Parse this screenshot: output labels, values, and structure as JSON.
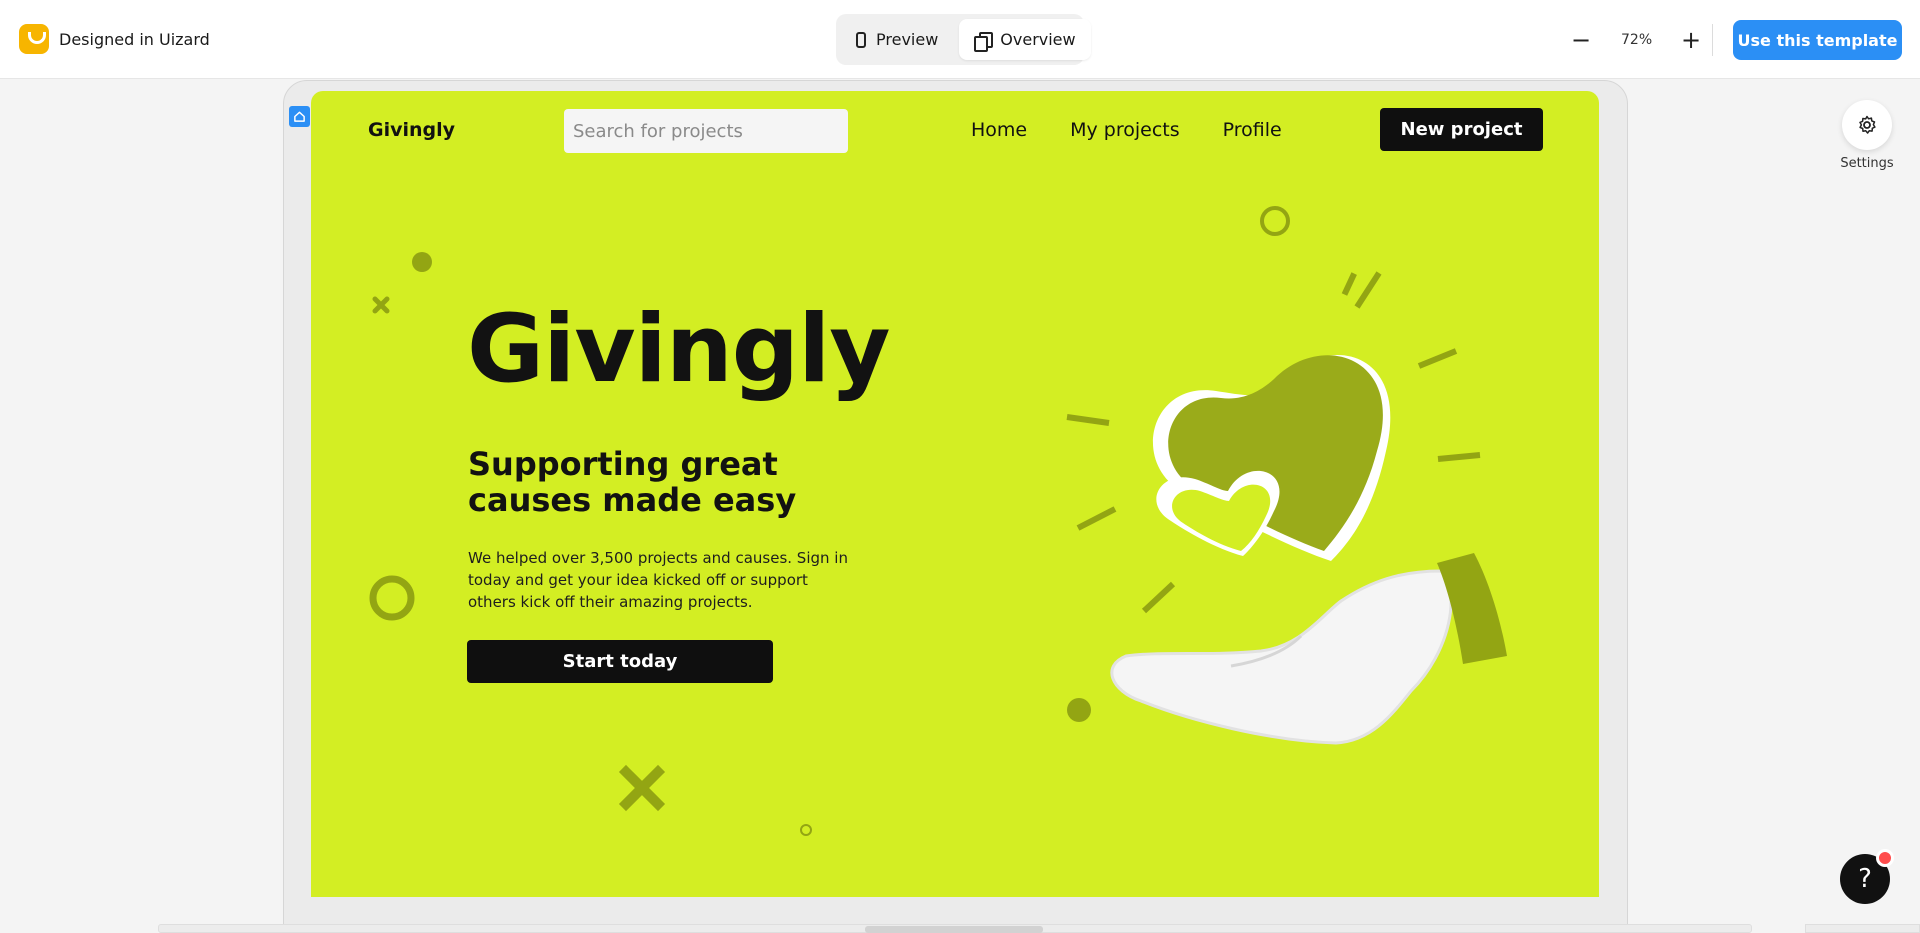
{
  "topbar": {
    "brand_label": "Designed in Uizard",
    "preview_label": "Preview",
    "overview_label": "Overview",
    "zoom_minus": "−",
    "zoom_level": "72%",
    "zoom_plus": "+",
    "use_template_label": "Use this template"
  },
  "site": {
    "logo": "Givingly",
    "search_placeholder": "Search for projects",
    "nav": [
      "Home",
      "My projects",
      "Profile"
    ],
    "new_project_label": "New project",
    "hero_title": "Givingly",
    "hero_subtitle": "Supporting great causes made easy",
    "hero_body": "We helped over 3,500 projects and causes. Sign in today and get your idea kicked off or support others kick off their amazing projects.",
    "hero_cta": "Start today"
  },
  "panel": {
    "settings_label": "Settings",
    "help_label": "?"
  },
  "colors": {
    "accent": "#2b8ff5",
    "brand_yellow": "#f7b500",
    "artboard_green": "#d3ee23",
    "deco_olive": "#93a513"
  }
}
